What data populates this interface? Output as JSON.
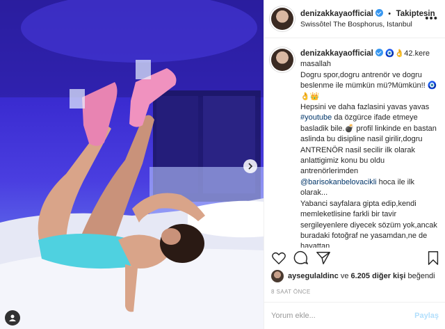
{
  "post": {
    "author": "denizakkayaofficial",
    "follow_state": "Takiptesin",
    "separator": "•",
    "location": "Swissôtel The Bosphorus, Istanbul",
    "more_icon": "more-horizontal-icon"
  },
  "caption": {
    "author": "denizakkayaofficial",
    "text": "🧿👌42.kere masallah\nDogru spor,dogru antrenör ve dogru beslenme ile mümkün mü?Mümkün!! 🧿👌👑\nHepsini ve daha fazlasini yavas yavas ",
    "hashtag": "#youtube",
    "text2": " da özgürce ifade etmeye basladik bile.💣 profil linkinde en bastan aslinda bu disipline nasil girilir,dogru ANTRENÖR nasil secilir ilk olarak anlattigimiz konu bu oldu antrenörlerimden\n",
    "mention": "@barisokanbelovacikli",
    "text3": " hoca ile ilk olarak...\nYabanci sayfalara gipta edip,kendi memleketlisine farkli bir tavir sergileyenlere diyecek sözüm yok,ancak buradaki fotoğraf ne yasamdan,ne de hayattan"
  },
  "actions": {
    "like_icon": "heart-icon",
    "comment_icon": "comment-icon",
    "share_icon": "share-icon",
    "save_icon": "bookmark-icon"
  },
  "likes": {
    "first_liker": "aysegulaldinc",
    "connector": "ve",
    "others": "6.205 diğer kişi",
    "suffix": "beğendi"
  },
  "timestamp": "8 SAAT ÖNCE",
  "comment": {
    "placeholder": "Yorum ekle...",
    "post_label": "Paylaş"
  },
  "colors": {
    "link": "#003569",
    "verified": "#3897f0",
    "post_button_disabled": "#b2dffc"
  }
}
